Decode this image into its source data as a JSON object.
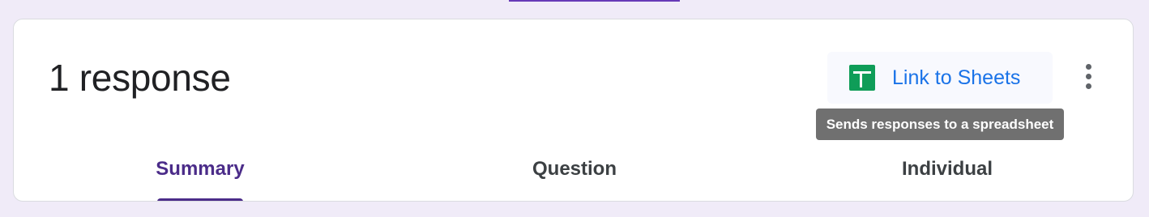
{
  "header": {
    "response_count": "1 response"
  },
  "actions": {
    "link_sheets_label": "Link to Sheets",
    "sheets_icon": "google-sheets-icon",
    "more_icon": "more-vert-icon",
    "tooltip": "Sends responses to a spreadsheet"
  },
  "tabs": [
    {
      "label": "Summary",
      "selected": true
    },
    {
      "label": "Question",
      "selected": false
    },
    {
      "label": "Individual",
      "selected": false
    }
  ],
  "colors": {
    "accent": "#4b2c89",
    "link": "#1a73e8",
    "sheets_green": "#0f9d58",
    "background": "#f0ebf8"
  }
}
